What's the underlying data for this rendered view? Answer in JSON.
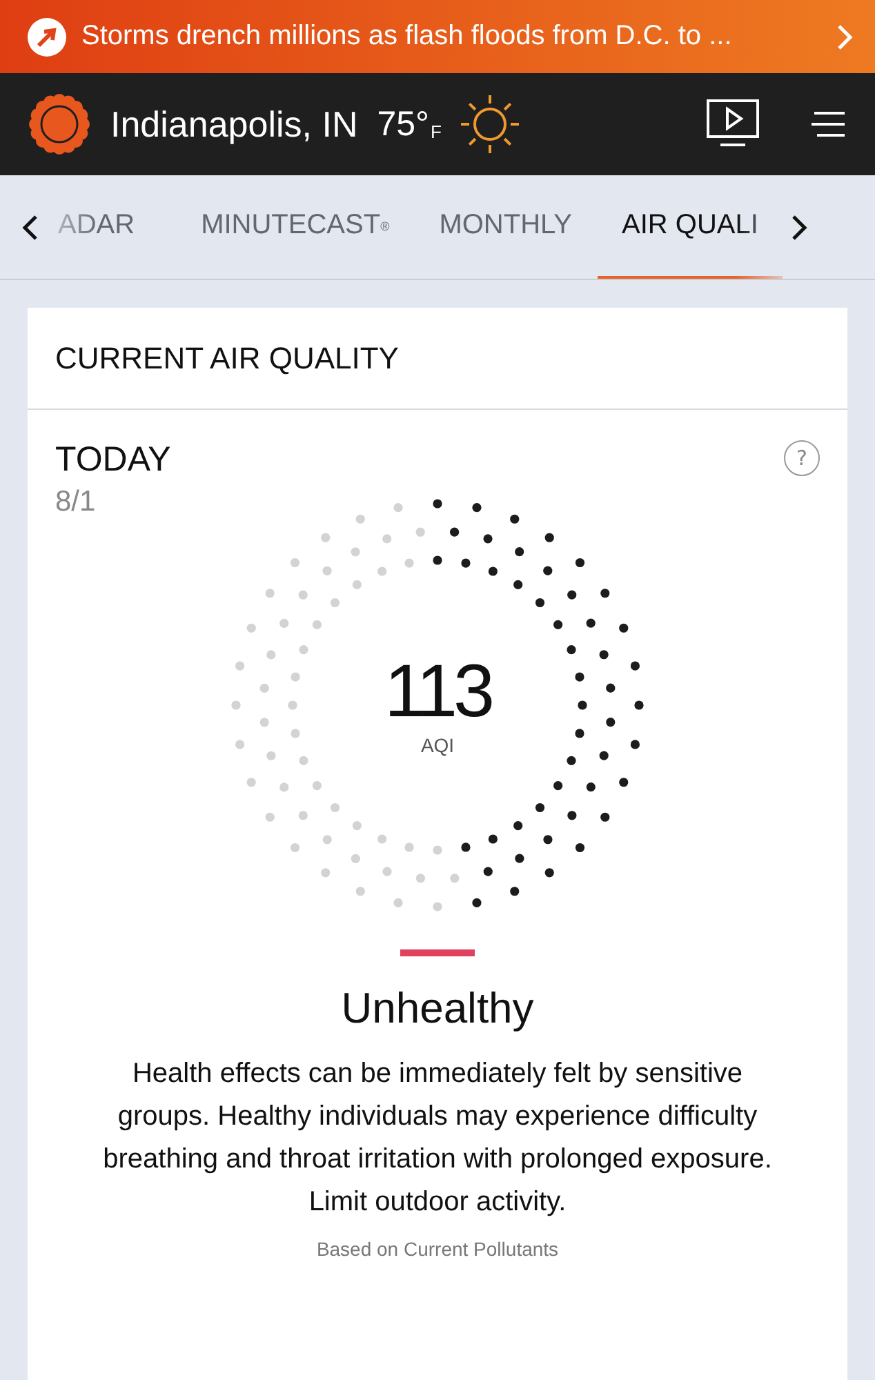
{
  "banner": {
    "text": "Storms drench millions as flash floods from D.C. to ..."
  },
  "header": {
    "city": "Indianapolis, IN",
    "temperature": "75°",
    "unit": "F"
  },
  "tabs": [
    {
      "label": "ADAR",
      "selected": false
    },
    {
      "label": "MINUTECAST$^{®}$",
      "selected": false
    },
    {
      "label": "MONTHLY",
      "selected": false
    },
    {
      "label": "AIR QUALI",
      "selected": true
    }
  ],
  "card": {
    "title": "CURRENT AIR QUALITY",
    "day": "TODAY",
    "date": "8/1",
    "help": "?",
    "dial": {
      "value": "113",
      "unit": "AQI"
    },
    "category": {
      "label": "Unhealthy",
      "color": "#e0415e"
    },
    "description": "Health effects can be immediately felt by sensitive groups. Healthy individuals may experience difficulty breathing and throat irritation with prolonged exposure. Limit outdoor activity.",
    "footnote": "Based on Current Pollutants"
  }
}
